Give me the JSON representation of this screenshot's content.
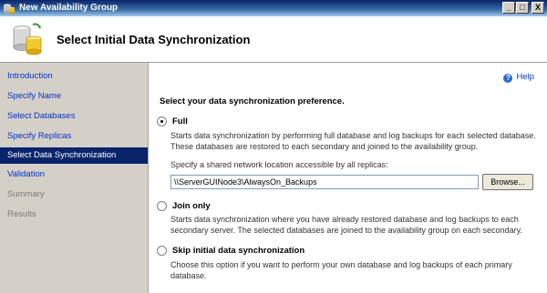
{
  "window": {
    "title": "New Availability Group",
    "controls": {
      "minimize": "_",
      "maximize": "□",
      "close": "X"
    }
  },
  "header": {
    "title": "Select Initial Data Synchronization"
  },
  "nav": {
    "items": [
      {
        "label": "Introduction",
        "state": "link"
      },
      {
        "label": "Specify Name",
        "state": "link"
      },
      {
        "label": "Select Databases",
        "state": "link"
      },
      {
        "label": "Specify Replicas",
        "state": "link"
      },
      {
        "label": "Select Data Synchronization",
        "state": "selected"
      },
      {
        "label": "Validation",
        "state": "link"
      },
      {
        "label": "Summary",
        "state": "disabled"
      },
      {
        "label": "Results",
        "state": "disabled"
      }
    ]
  },
  "main": {
    "help": "Help",
    "prompt": "Select your data synchronization preference.",
    "options": [
      {
        "label": "Full",
        "checked": true,
        "description": "Starts data synchronization by performing full database and log backups for each selected database. These databases are restored to each secondary and joined to the availability group."
      },
      {
        "label": "Join only",
        "checked": false,
        "description": "Starts data synchronization where you have already restored database and log backups to each secondary server. The selected databases are joined to the availability group on each secondary."
      },
      {
        "label": "Skip initial data synchronization",
        "checked": false,
        "description": "Choose this option if you want to perform your own database and log backups of each primary database."
      }
    ],
    "share_label": "Specify a shared network location accessible by all replicas:",
    "share_value": "\\\\ServerGUINode3\\AlwaysOn_Backups",
    "browse_label": "Browse..."
  },
  "colors": {
    "nav_selected": "#0a246a",
    "link": "#0033cc",
    "nav_background": "#d4d0c8"
  }
}
